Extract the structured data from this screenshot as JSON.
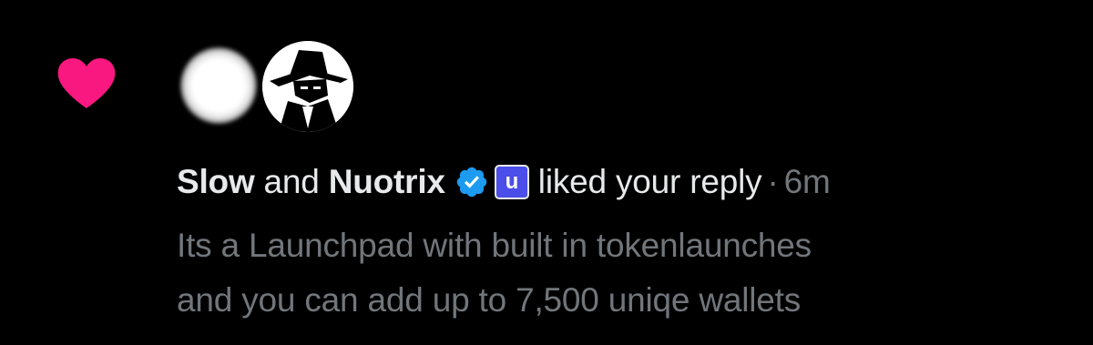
{
  "notification": {
    "icon": "heart-icon",
    "icon_color": "#f91880",
    "avatars": [
      {
        "name": "blurred-avatar",
        "description_icon": "avatar"
      },
      {
        "name": "spy-avatar",
        "description_icon": "spy-avatar-icon"
      }
    ],
    "headline": {
      "user1": "Slow",
      "conjunction": "and",
      "user2": "Nuotrix",
      "verified_icon": "verified-badge-icon",
      "verified_color": "#1d9bf0",
      "affiliate_badge": "u",
      "affiliate_color": "#4b4ee8",
      "action": "liked your reply",
      "separator": "·",
      "time": "6m"
    },
    "reply_lines": [
      "Its a Launchpad with built in tokenlaunches",
      "and you can add up to 7,500 uniqe wallets"
    ]
  },
  "colors": {
    "background": "#000000",
    "primary_text": "#e7e9ea",
    "secondary_text": "#71767b"
  }
}
